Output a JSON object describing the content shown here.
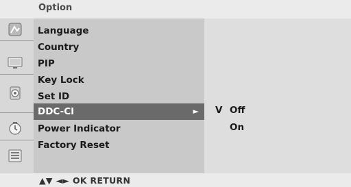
{
  "header": {
    "title": "Option"
  },
  "menu": {
    "items": [
      {
        "label": "Language"
      },
      {
        "label": "Country"
      },
      {
        "label": "PIP"
      },
      {
        "label": "Key Lock"
      },
      {
        "label": "Set ID"
      },
      {
        "label": "DDC-CI",
        "selected": true,
        "arrow": "►"
      },
      {
        "label": "Power Indicator"
      },
      {
        "label": "Factory Reset"
      }
    ]
  },
  "submenu": {
    "check_mark": "V",
    "options": [
      {
        "label": "Off",
        "checked": true
      },
      {
        "label": "On",
        "checked": false
      }
    ]
  },
  "sidebar": {
    "icons": [
      "picture-icon",
      "screen-icon",
      "speaker-icon",
      "clock-icon",
      "menu-icon"
    ]
  },
  "footer": {
    "nav_hint": "▲▼  ◄►  OK  RETURN"
  },
  "colors": {
    "selected_bg": "#6a6a6a",
    "menu_bg": "#c9c9c9",
    "submenu_bg": "#dedede",
    "header_bg": "#ebebeb"
  }
}
